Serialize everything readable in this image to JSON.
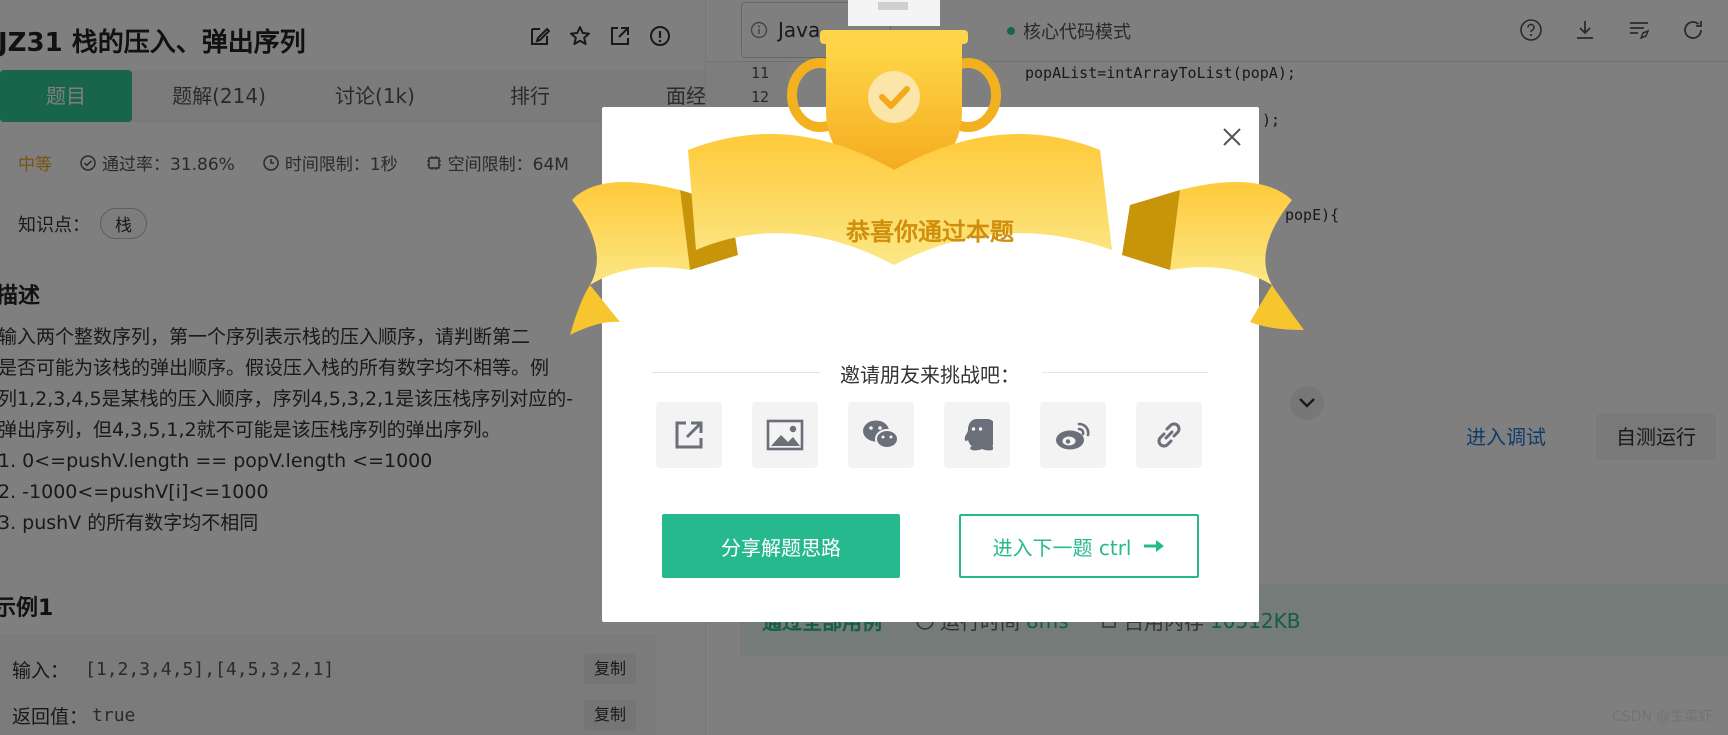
{
  "problem": {
    "title": "JZ31  栈的压入、弹出序列",
    "tabs": [
      "题目",
      "题解(214)",
      "讨论(1k)",
      "排行",
      "面经"
    ],
    "difficulty": "中等",
    "pass_rate": "通过率：31.86%",
    "time_limit": "时间限制：1秒",
    "space_limit": "空间限制：64M",
    "knowledge_label": "知识点：",
    "knowledge_tag": "栈",
    "desc_heading": "描述",
    "desc_lines": [
      "输入两个整数序列，第一个序列表示栈的压入顺序，请判断第二",
      "是否可能为该栈的弹出顺序。假设压入栈的所有数字均不相等。例",
      "列1,2,3,4,5是某栈的压入顺序，序列4,5,3,2,1是该压栈序列对应的-",
      "弹出序列，但4,3,5,1,2就不可能是该压栈序列的弹出序列。",
      "1. 0<=pushV.length == popV.length <=1000",
      "2. -1000<=pushV[i]<=1000",
      "3. pushV 的所有数字均不相同"
    ],
    "example_heading": "示例1",
    "input_label": "输入：",
    "input_value": "[1,2,3,4,5],[4,5,3,2,1]",
    "return_label": "返回值：",
    "return_value": "true",
    "copy_label": "复制"
  },
  "editor": {
    "language": "Java",
    "mode": "核心代码模式",
    "line_11": "11",
    "line_12": "12",
    "code_11": "popAList=intArrayToList(popA);",
    "code_12": ");",
    "code_b": "popE){",
    "debug_label": "进入调试",
    "selfrun_label": "自测运行",
    "result_pass": "通过全部用例",
    "result_time_label": "运行时间",
    "result_time": "8ms",
    "result_mem_label": "占用内存",
    "result_mem": "10512KB"
  },
  "modal": {
    "congrats": "恭喜你通过本题",
    "invite": "邀请朋友来挑战吧：",
    "share_icons": [
      "share-out-icon",
      "image-icon",
      "wechat-icon",
      "qq-icon",
      "weibo-icon",
      "link-icon"
    ],
    "share_btn": "分享解题思路",
    "next_btn": "进入下一题 ctrl"
  },
  "watermark": "CSDN @生菜虾",
  "colors": {
    "accent": "#32ca99",
    "gold": "#f5b72b",
    "link": "#1f7ad4"
  }
}
